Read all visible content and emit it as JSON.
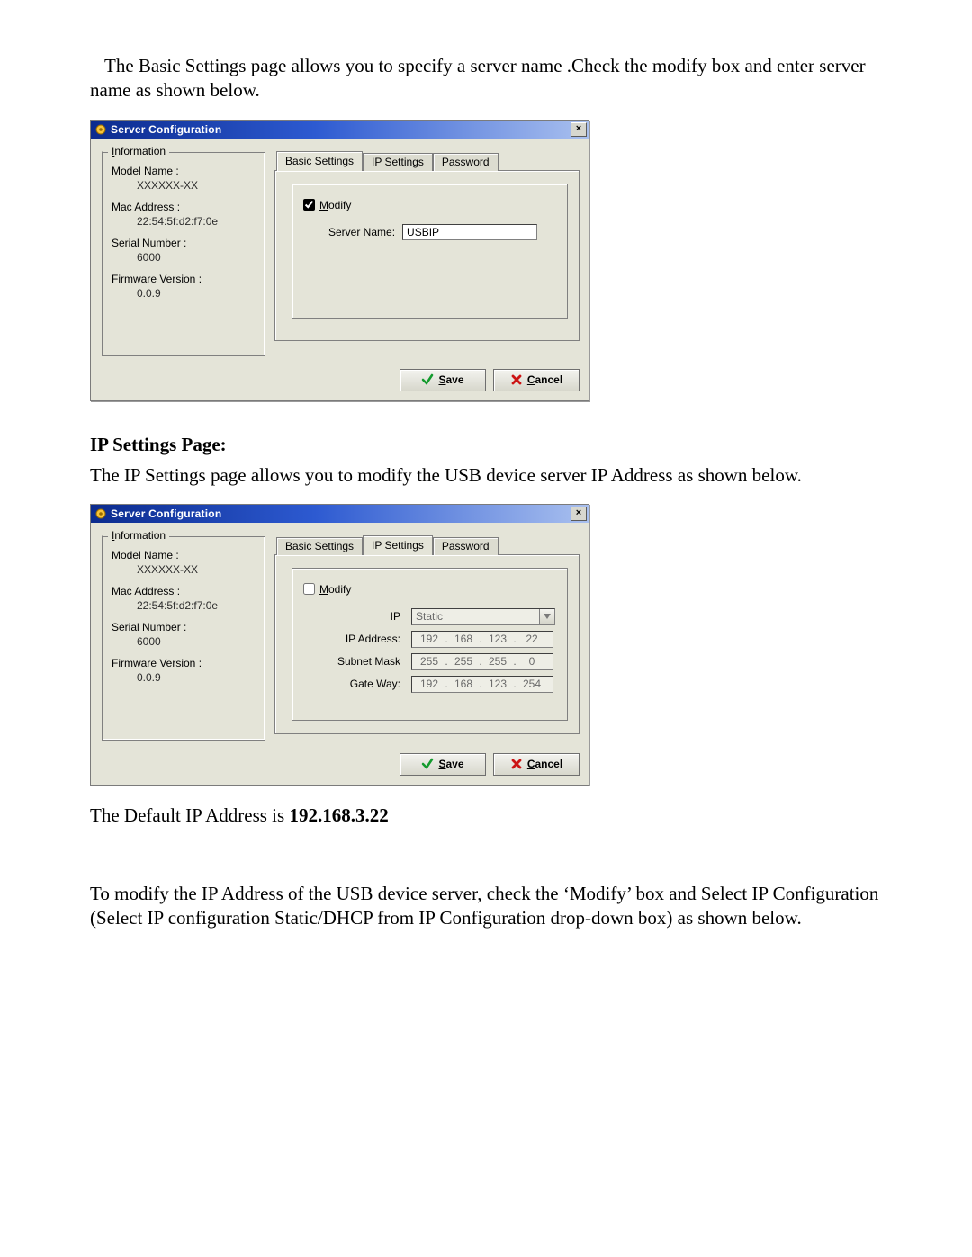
{
  "doc": {
    "intro": "The Basic Settings page allows you to specify a server name .Check the modify box and enter server name as shown below.",
    "ip_heading": "IP Settings Page:",
    "ip_text": "The IP Settings page allows you to modify the USB device server IP Address as shown below.",
    "default_ip_prefix": "The Default IP Address is ",
    "default_ip_value": "192.168.3.22",
    "modify_para": "To modify the IP Address of the USB device server, check the ‘Modify’ box and Select IP Configuration (Select IP configuration Static/DHCP from IP Configuration drop-down box) as shown below."
  },
  "dlg": {
    "title": "Server Configuration",
    "info": {
      "legend": "Information",
      "model_label": "Model Name :",
      "model_value": "XXXXXX-XX",
      "mac_label": "Mac Address :",
      "mac_value": "22:54:5f:d2:f7:0e",
      "serial_label": "Serial Number :",
      "serial_value": "6000",
      "fw_label": "Firmware Version :",
      "fw_value": "0.0.9"
    },
    "tabs": {
      "basic": "Basic Settings",
      "ip": "IP Settings",
      "pwd": "Password"
    },
    "basic_panel": {
      "modify_label": "Modify",
      "server_name_label": "Server Name:",
      "server_name_value": "USBIP"
    },
    "ip_panel": {
      "modify_label": "Modify",
      "ip_label": "IP",
      "ip_mode": "Static",
      "ip_addr_label": "IP Address:",
      "ip_addr": [
        "192",
        "168",
        "123",
        "22"
      ],
      "subnet_label": "Subnet Mask",
      "subnet": [
        "255",
        "255",
        "255",
        "0"
      ],
      "gw_label": "Gate Way:",
      "gw": [
        "192",
        "168",
        "123",
        "254"
      ]
    },
    "buttons": {
      "save": "Save",
      "cancel": "Cancel"
    }
  }
}
